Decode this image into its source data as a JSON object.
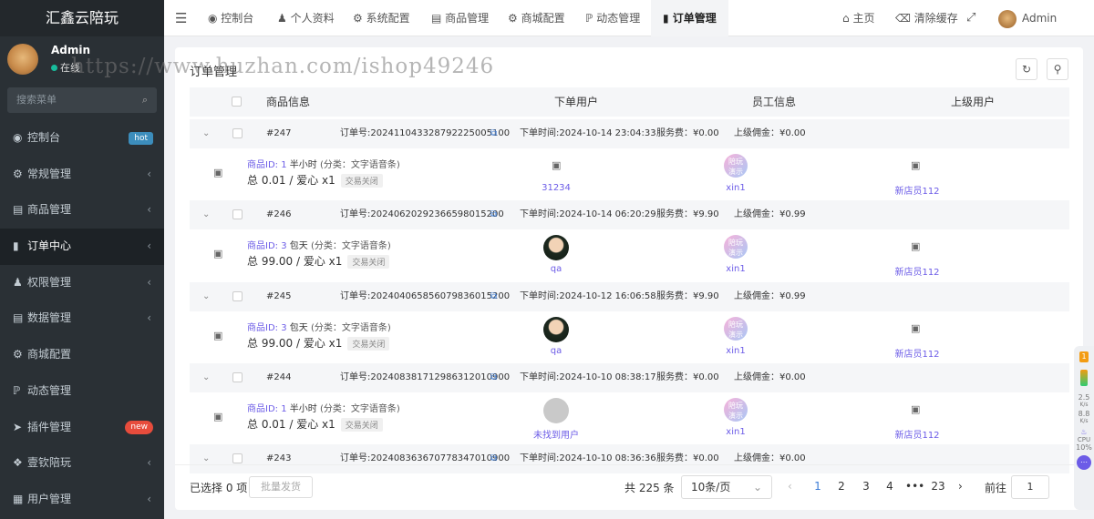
{
  "brand": "汇鑫云陪玩",
  "user": {
    "name": "Admin",
    "status": "在线"
  },
  "search": {
    "placeholder": "搜索菜单"
  },
  "sidebar": {
    "items": [
      {
        "label": "控制台",
        "badge": "hot",
        "icon": "dashboard-icon"
      },
      {
        "label": "常规管理",
        "icon": "cogs-icon"
      },
      {
        "label": "商品管理",
        "icon": "store-icon"
      },
      {
        "label": "订单中心",
        "icon": "file-icon"
      },
      {
        "label": "权限管理",
        "icon": "users-icon"
      },
      {
        "label": "数据管理",
        "icon": "chart-icon"
      },
      {
        "label": "商城配置",
        "icon": "cogs-icon"
      },
      {
        "label": "动态管理",
        "icon": "rss-icon"
      },
      {
        "label": "插件管理",
        "badge": "new",
        "icon": "rocket-icon"
      },
      {
        "label": "壹钦陪玩",
        "icon": "dropbox-icon"
      },
      {
        "label": "用户管理",
        "icon": "idcard-icon"
      }
    ]
  },
  "topbar": {
    "tabs": [
      "控制台",
      "个人资料",
      "系统配置",
      "商品管理",
      "商城配置",
      "动态管理",
      "订单管理"
    ],
    "home": "主页",
    "clear_cache": "清除缓存",
    "admin": "Admin"
  },
  "watermark": "https://www.huzhan.com/ishop49246",
  "panel": {
    "title": "订单管理"
  },
  "table": {
    "headers": [
      "商品信息",
      "下单用户",
      "员工信息",
      "上级用户"
    ]
  },
  "orders": [
    {
      "id": "#247",
      "order_no": "订单号:20241104332879222500510​0",
      "time": "下单时间:2024-10-14 23:04:33",
      "fee": "服务费：¥0.00",
      "commission": "上级佣金：¥0.00",
      "product_id": "商品ID: 1",
      "product_name": "半小时",
      "category": "(分类：文字语音条)",
      "total": "总 0.01 / 爱心  x1",
      "status": "交易关闭",
      "buyer": "31234",
      "buyer_avatar": "none",
      "staff": "xin1",
      "parent": "新店员112"
    },
    {
      "id": "#246",
      "order_no": "订单号:20240620292366598015200",
      "time": "下单时间:2024-10-14 06:20:29",
      "fee": "服务费：¥9.90",
      "commission": "上级佣金：¥0.99",
      "product_id": "商品ID: 3",
      "product_name": "包天",
      "category": "(分类：文字语音条)",
      "total": "总 99.00 / 爱心  x1",
      "status": "交易关闭",
      "buyer": "qa",
      "buyer_avatar": "dark",
      "staff": "xin1",
      "parent": "新店员112"
    },
    {
      "id": "#245",
      "order_no": "订单号:20240406585607983601520​0",
      "time": "下单时间:2024-10-12 16:06:58",
      "fee": "服务费：¥9.90",
      "commission": "上级佣金：¥0.99",
      "product_id": "商品ID: 3",
      "product_name": "包天",
      "category": "(分类：文字语音条)",
      "total": "总 99.00 / 爱心  x1",
      "status": "交易关闭",
      "buyer": "qa",
      "buyer_avatar": "dark",
      "staff": "xin1",
      "parent": "新店员112"
    },
    {
      "id": "#244",
      "order_no": "订单号:20240838171298631201090​0",
      "time": "下单时间:2024-10-10 08:38:17",
      "fee": "服务费：¥0.00",
      "commission": "上级佣金：¥0.00",
      "product_id": "商品ID: 1",
      "product_name": "半小时",
      "category": "(分类：文字语音条)",
      "total": "总 0.01 / 爱心  x1",
      "status": "交易关闭",
      "buyer": "未找到用户",
      "buyer_avatar": "gray",
      "staff": "xin1",
      "parent": "新店员112"
    },
    {
      "id": "#243",
      "order_no": "订单号:20240836367077834701090​0",
      "time": "下单时间:2024-10-10 08:36:36",
      "fee": "服务费：¥0.00",
      "commission": "上级佣金：¥0.00"
    }
  ],
  "staff_avatar_text": "陪玩\n演示",
  "footer": {
    "selected": "已选择 0 项",
    "batch": "批量发货",
    "total": "共 225 条",
    "per_page": "10条/页",
    "pages": [
      "1",
      "2",
      "3",
      "4",
      "•••",
      "23"
    ],
    "current_page": 1,
    "goto_label": "前往",
    "goto_value": "1"
  },
  "floatbar": {
    "badge": "1",
    "net_up": "2.5",
    "net_up_unit": "K/s",
    "net_down": "8.8",
    "net_down_unit": "K/s",
    "cpu_label": "CPU",
    "cpu": "10%"
  }
}
